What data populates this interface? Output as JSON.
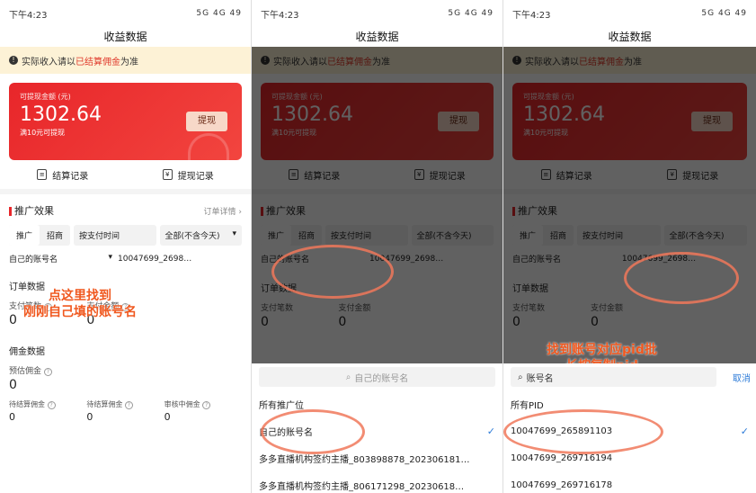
{
  "panels": [
    {
      "status": {
        "time": "下午4:23",
        "signal": "5G 4G 49"
      },
      "title": "收益数据",
      "notice": {
        "pre": "实际收入请以",
        "hl": "已结算佣金",
        "post": "为准"
      },
      "card": {
        "label": "可提现金额 (元)",
        "amount": "1302.64",
        "sub": "满10元可提现",
        "button": "提现"
      },
      "records": [
        "结算记录",
        "提现记录"
      ],
      "section": {
        "title": "推广效果",
        "link": "订单详情 ›"
      },
      "filters": {
        "tab1": "推广",
        "tab2": "招商",
        "sort": "按支付时间",
        "range": "全部(不含今天)"
      },
      "account": {
        "name": "自己的账号名",
        "pid": "10047699_2698…"
      },
      "orders_title": "订单数据",
      "orders": [
        {
          "label": "支付笔数",
          "value": "0"
        },
        {
          "label": "支付金额",
          "value": "0"
        }
      ],
      "commission_title": "佣金数据",
      "commission_main": {
        "label": "预估佣金",
        "value": "0"
      },
      "commission_sub": [
        {
          "label": "待结算佣金",
          "value": "0"
        },
        {
          "label": "待结算佣金",
          "value": "0"
        },
        {
          "label": "审核中佣金",
          "value": "0"
        }
      ],
      "annotation": "点这里找到\n刚刚自己填的账号名"
    },
    {
      "status": {
        "time": "下午4:23",
        "signal": "5G 4G 49"
      },
      "title": "收益数据",
      "search_placeholder": "自己的账号名",
      "options": [
        "所有推广位",
        "自己的账号名",
        "多多直播机构签约主播_803898878_202306181…",
        "多多直播机构签约主播_806171298_20230618…"
      ]
    },
    {
      "status": {
        "time": "下午4:23",
        "signal": "5G 4G 49"
      },
      "title": "收益数据",
      "search_value": "账号名",
      "cancel": "取消",
      "options": [
        "所有PID",
        "10047699_265891103",
        "10047699_269716194",
        "10047699_269716178"
      ],
      "annotation": "找到账号对应pid批\n长按复制pid"
    }
  ]
}
